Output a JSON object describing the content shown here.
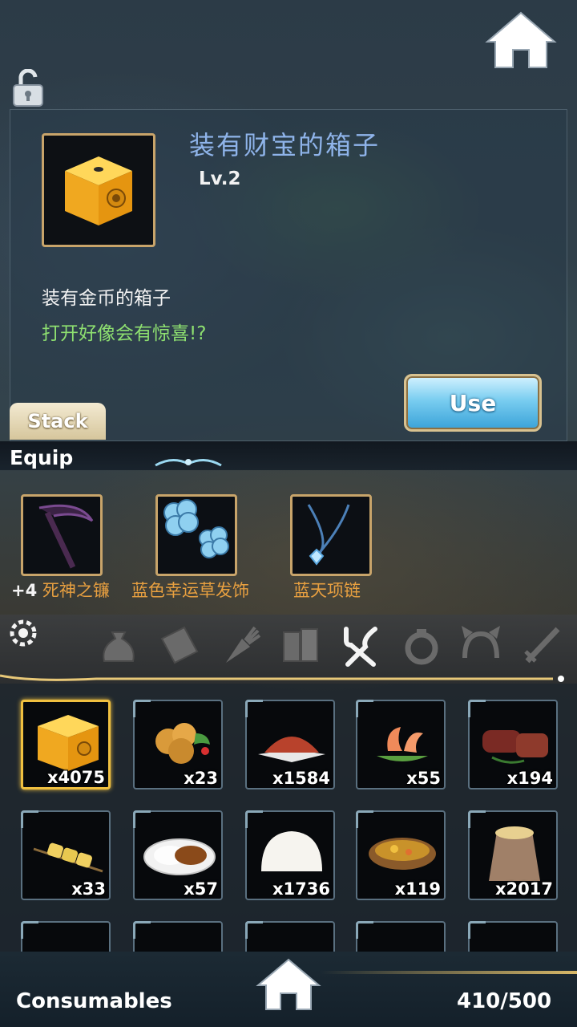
{
  "detail": {
    "item_name": "装有财宝的箱子",
    "level": "Lv.2",
    "desc_line1": "装有金币的箱子",
    "desc_line2": "打开好像会有惊喜!?",
    "use_label": "Use",
    "stack_label": "Stack",
    "icon": "treasure-box-icon"
  },
  "equip": {
    "label": "Equip",
    "items": [
      {
        "prefix": "+4",
        "name": "死神之镰",
        "icon": "scythe-icon"
      },
      {
        "prefix": "",
        "name": "蓝色幸运草发饰",
        "icon": "clover-hairpin-icon"
      },
      {
        "prefix": "",
        "name": "蓝天项链",
        "icon": "necklace-icon"
      }
    ]
  },
  "categories": [
    {
      "icon": "bag-icon",
      "active": false
    },
    {
      "icon": "envelope-icon",
      "active": false
    },
    {
      "icon": "carrot-icon",
      "active": false
    },
    {
      "icon": "books-icon",
      "active": false
    },
    {
      "icon": "fork-knife-icon",
      "active": true
    },
    {
      "icon": "ring-icon",
      "active": false
    },
    {
      "icon": "headband-icon",
      "active": false
    },
    {
      "icon": "sword-icon",
      "active": false
    }
  ],
  "inventory": [
    {
      "qty": "x4075",
      "icon": "treasure-box-icon",
      "selected": true
    },
    {
      "qty": "x23",
      "icon": "fried-chicken-icon"
    },
    {
      "qty": "x1584",
      "icon": "spice-powder-icon"
    },
    {
      "qty": "x55",
      "icon": "shrimp-dish-icon"
    },
    {
      "qty": "x194",
      "icon": "steak-icon"
    },
    {
      "qty": "x33",
      "icon": "skewer-icon"
    },
    {
      "qty": "x57",
      "icon": "curry-rice-icon"
    },
    {
      "qty": "x1736",
      "icon": "bun-icon"
    },
    {
      "qty": "x119",
      "icon": "stew-bowl-icon"
    },
    {
      "qty": "x2017",
      "icon": "flour-sack-icon"
    }
  ],
  "footer": {
    "category_title": "Consumables",
    "capacity": "410/500"
  },
  "colors": {
    "gold_frame": "#c8a46a",
    "name_blue": "#8fb4ea",
    "desc_green": "#8ee070",
    "equip_orange": "#e8a040",
    "selected_border": "#f0c040"
  }
}
